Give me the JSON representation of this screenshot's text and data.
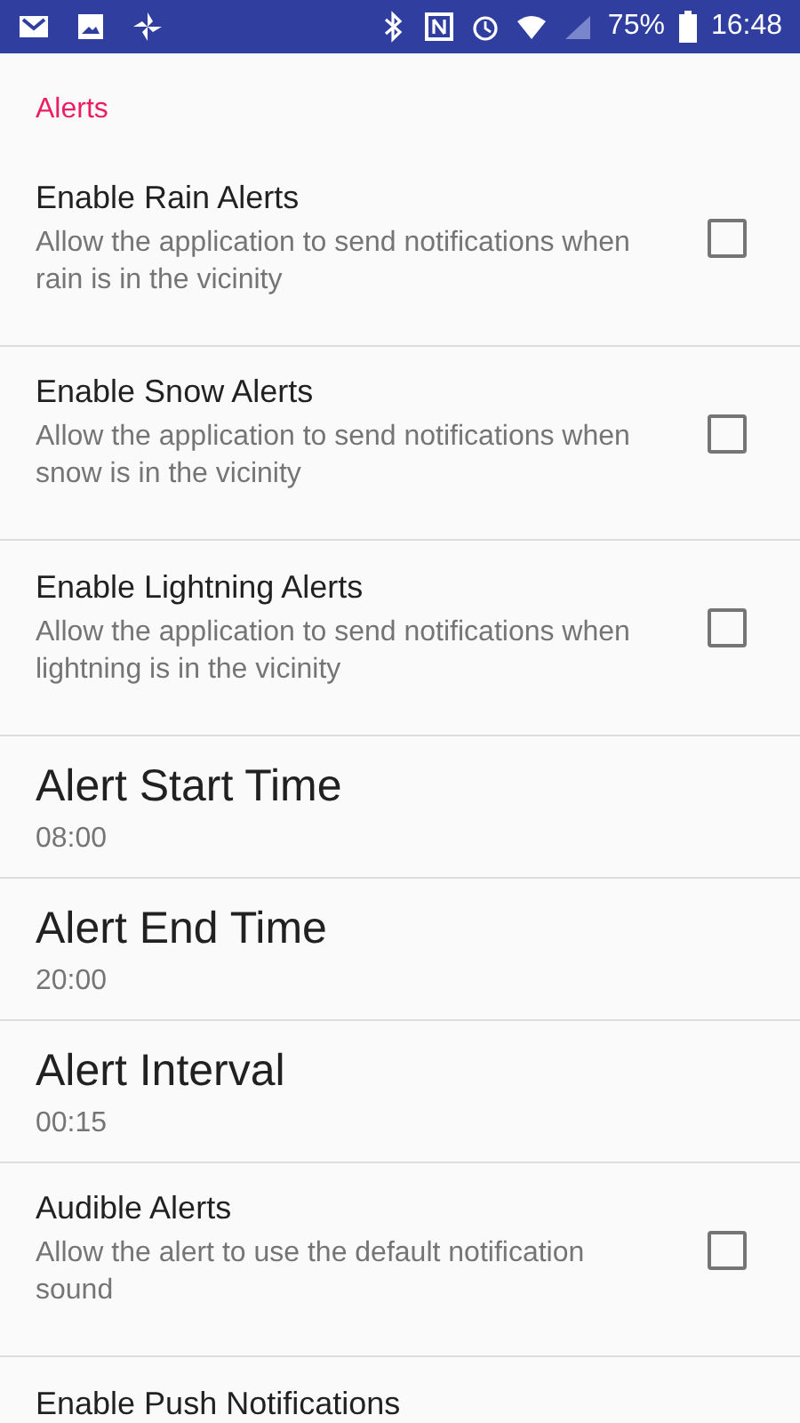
{
  "status_bar": {
    "battery": "75%",
    "time": "16:48"
  },
  "section": "Alerts",
  "items": [
    {
      "kind": "checkbox",
      "title": "Enable Rain Alerts",
      "summary": "Allow the application to send notifications when rain is in the vicinity",
      "checked": false
    },
    {
      "kind": "checkbox",
      "title": "Enable Snow Alerts",
      "summary": "Allow the application to send notifications when snow is in the vicinity",
      "checked": false
    },
    {
      "kind": "checkbox",
      "title": "Enable Lightning Alerts",
      "summary": "Allow the application to send notifications when lightning is in the vicinity",
      "checked": false
    },
    {
      "kind": "time",
      "title": "Alert Start Time",
      "value": "08:00"
    },
    {
      "kind": "time",
      "title": "Alert End Time",
      "value": "20:00"
    },
    {
      "kind": "time",
      "title": "Alert Interval",
      "value": "00:15"
    },
    {
      "kind": "checkbox",
      "title": "Audible Alerts",
      "summary": "Allow the alert to use the default notification sound",
      "checked": false
    },
    {
      "kind": "partial",
      "title": "Enable Push Notifications"
    }
  ]
}
